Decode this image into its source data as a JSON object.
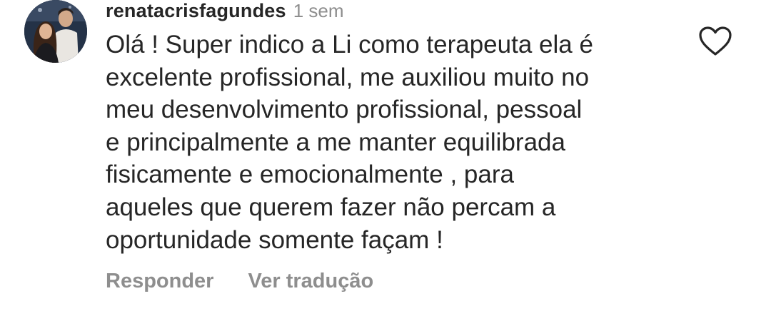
{
  "comment": {
    "username": "renatacrisfagundes",
    "timestamp": "1 sem",
    "avatar": "profile-photo",
    "lines": [
      "Olá ! Super indico a Li como terapeuta ela é",
      "excelente profissional, me auxiliou muito no",
      "meu desenvolvimento profissional, pessoal",
      "e principalmente a me manter equilibrada",
      "fisicamente e emocionalmente , para",
      "aqueles que querem fazer não percam a",
      "oportunidade somente façam !"
    ],
    "actions": {
      "reply": "Responder",
      "translate": "Ver tradução"
    },
    "like_icon": "heart-outline-icon"
  },
  "colors": {
    "text": "#262626",
    "secondary": "#8e8e8e",
    "background": "#ffffff"
  }
}
